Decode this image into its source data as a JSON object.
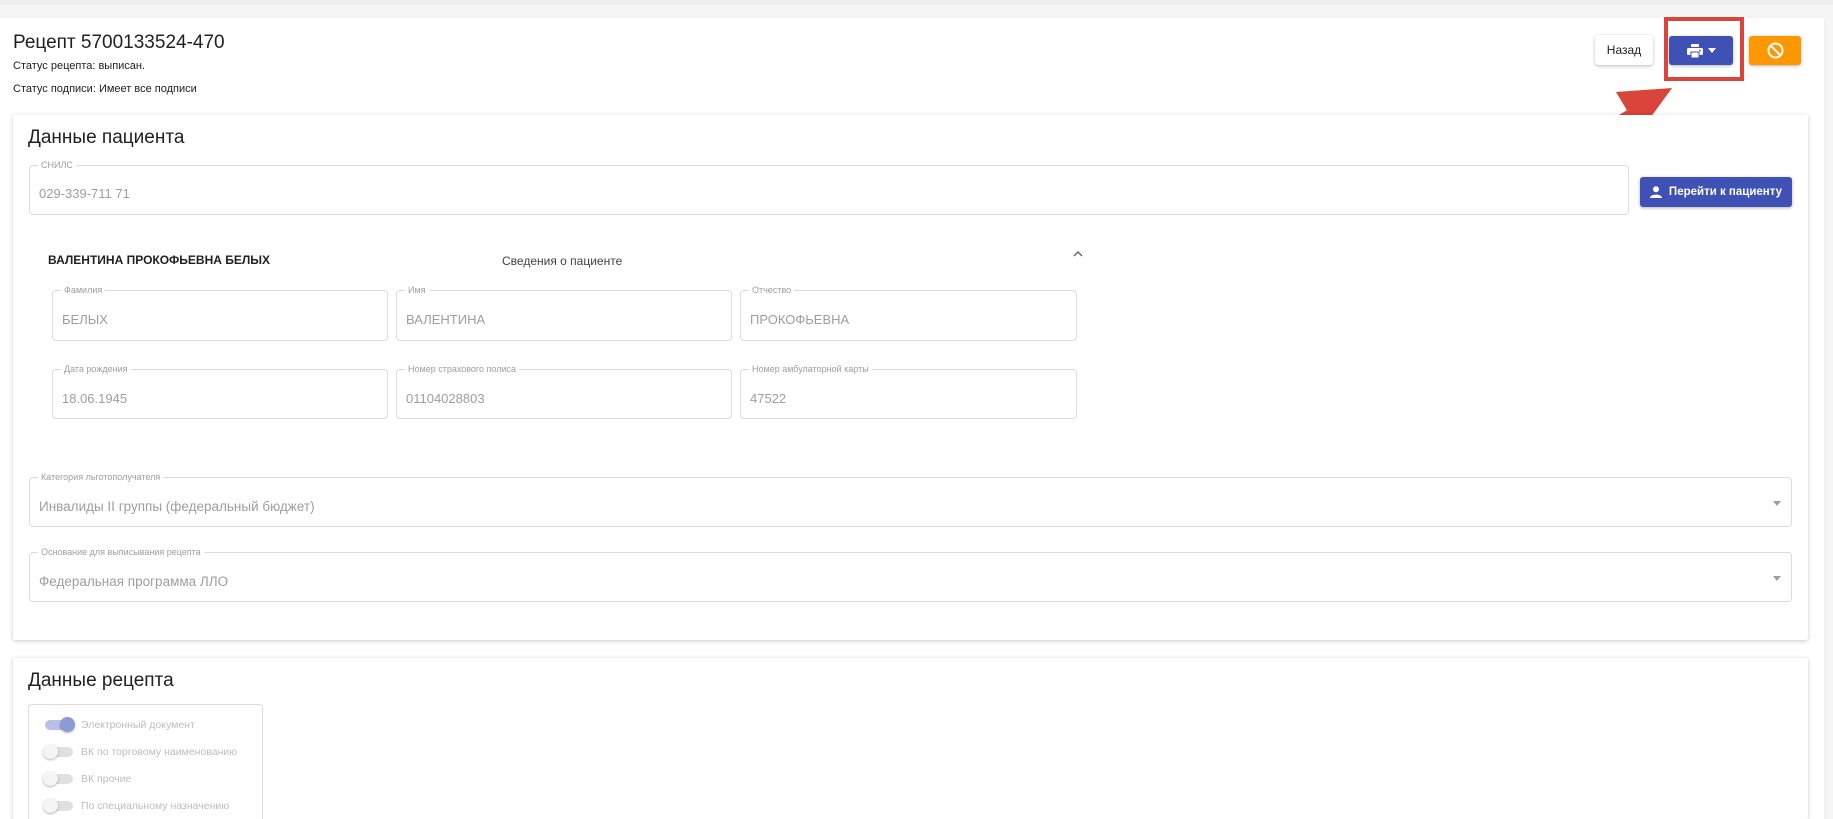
{
  "header": {
    "title": "Рецепт 5700133524-470",
    "status": "Статус рецепта: выписан.",
    "signature": "Статус подписи: Имеет все подписи"
  },
  "toolbar": {
    "back_label": "Назад",
    "print_icon": "printer-icon",
    "cancel_icon": "block-icon"
  },
  "annotation": {
    "color": "#d9453a"
  },
  "patient": {
    "section_title": "Данные пациента",
    "snils": {
      "label": "СНИЛС",
      "value": "029-339-711 71"
    },
    "goto_label": "Перейти к пациенту",
    "full_name": "ВАЛЕНТИНА ПРОКОФЬЕВНА БЕЛЫХ",
    "info_label": "Сведения о пациенте",
    "fields": {
      "last_name": {
        "label": "Фамилия",
        "value": "БЕЛЫХ"
      },
      "first_name": {
        "label": "Имя",
        "value": "ВАЛЕНТИНА"
      },
      "patronymic": {
        "label": "Отчество",
        "value": "ПРОКОФЬЕВНА"
      },
      "birth_date": {
        "label": "Дата рождения",
        "value": "18.06.1945"
      },
      "policy": {
        "label": "Номер страхового полиса",
        "value": "01104028803"
      },
      "card": {
        "label": "Номер амбулаторной карты",
        "value": "47522"
      }
    },
    "category": {
      "label": "Категория льготополучателя",
      "value": "Инвалиды II группы (федеральный бюджет)"
    },
    "basis": {
      "label": "Основание для выписывания рецепта",
      "value": "Федеральная программа ЛЛО"
    }
  },
  "prescription": {
    "section_title": "Данные рецепта",
    "switches": [
      {
        "label": "Электронный документ",
        "on": true
      },
      {
        "label": "ВК по торговому наименованию",
        "on": false
      },
      {
        "label": "ВК прочие",
        "on": false
      },
      {
        "label": "По специальному назначению",
        "on": false
      }
    ]
  },
  "colors": {
    "primary": "#3f51b5",
    "warning": "#ff9800"
  }
}
